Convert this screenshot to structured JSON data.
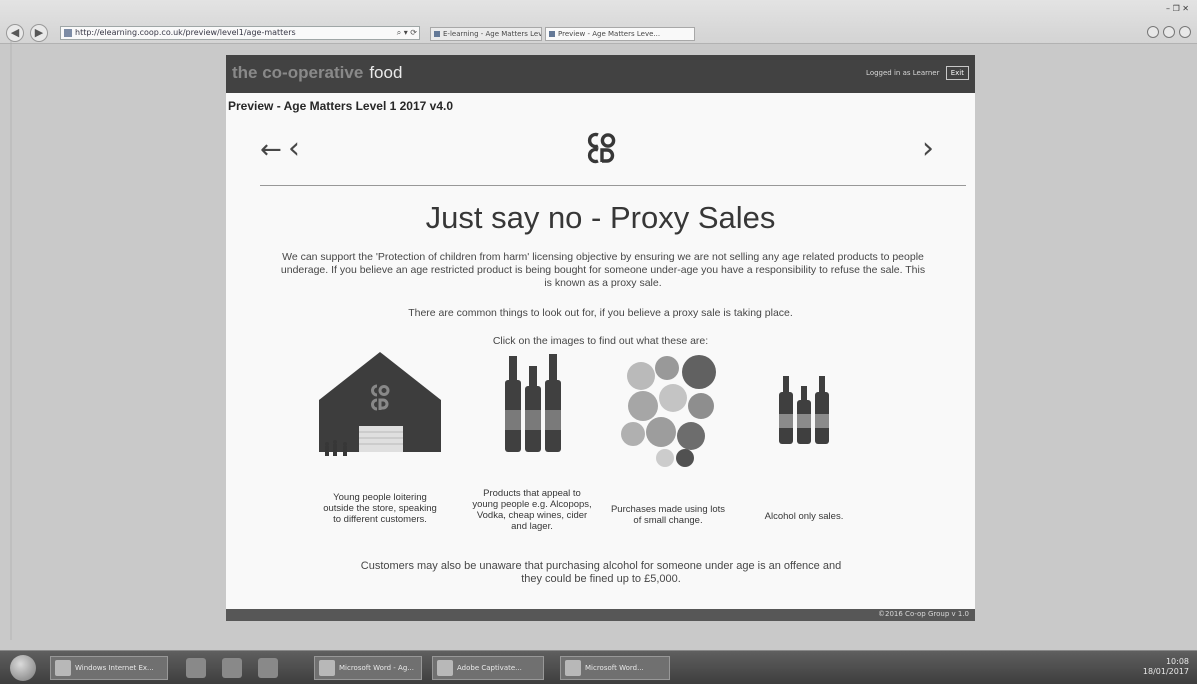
{
  "browser": {
    "address": "http://elearning.coop.co.uk/preview/level1/age-matters",
    "tabs": [
      {
        "label": "E-learning - Age Matters Level..."
      },
      {
        "label": "Preview - Age Matters Leve..."
      }
    ],
    "window_controls": "–  ❐  ✕"
  },
  "site": {
    "brand_coop": "the co-operative",
    "brand_food": "food",
    "user_label": "Logged in as Learner",
    "exit_label": "Exit"
  },
  "preview_title": "Preview - Age Matters Level 1 2017 v4.0",
  "nav": {
    "back": "←",
    "prev": "‹",
    "next": "›"
  },
  "slide": {
    "title": "Just say no - Proxy Sales",
    "intro": "We can support the 'Protection of children from harm' licensing objective by ensuring we are not selling any age related products to people underage. If you believe an age restricted product is being bought for someone under-age you have a responsibility to refuse the sale. This is known as a proxy sale.",
    "lookout": "There are common things to look out for, if you believe a proxy sale is taking place.",
    "click_prompt": "Click on the images to find out what these are:",
    "cards": [
      {
        "caption": "Young people loitering outside the store, speaking to different customers.",
        "icon": "store-building-icon"
      },
      {
        "caption": "Products that appeal to young people e.g. Alcopops, Vodka, cheap wines, cider and lager.",
        "icon": "bottles-icon"
      },
      {
        "caption": "Purchases made using lots of small change.",
        "icon": "coins-icon"
      },
      {
        "caption": "Alcohol only sales.",
        "icon": "beer-bottles-icon"
      }
    ],
    "footer_note": "Customers may also be unaware that purchasing alcohol for someone under age is an offence and they could be fined up to £5,000.",
    "footer_bar": "©2016 Co-op Group  v 1.0"
  },
  "taskbar": {
    "buttons": [
      {
        "label": "Windows Internet Ex..."
      },
      {
        "label": "Microsoft Word - Ag..."
      },
      {
        "label": "Adobe Captivate..."
      },
      {
        "label": "Microsoft Word..."
      }
    ],
    "clock_time": "10:08",
    "clock_date": "18/01/2017"
  },
  "colors": {
    "brand_bar": "#3f3f3f",
    "page_bg": "#ffffff",
    "desktop_bg": "#c9c9c9"
  }
}
